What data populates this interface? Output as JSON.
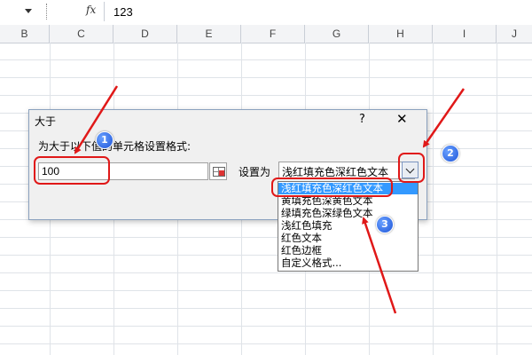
{
  "formula_bar": {
    "fx": "fx",
    "cancel": "✕",
    "enter": "✓",
    "value": "123"
  },
  "columns": [
    "B",
    "C",
    "D",
    "E",
    "F",
    "G",
    "H",
    "I",
    "J"
  ],
  "dialog": {
    "title": "大于",
    "help": "?",
    "close": "✕",
    "prompt": "为大于以下值的单元格设置格式:",
    "value": "100",
    "set_label": "设置为",
    "selected_format": "浅红填充色深红色文本",
    "options": [
      "浅红填充色深红色文本",
      "黄填充色深黄色文本",
      "绿填充色深绿色文本",
      "浅红色填充",
      "红色文本",
      "红色边框",
      "自定义格式..."
    ]
  },
  "annotations": [
    "1",
    "2",
    "3"
  ],
  "colors": {
    "annotation_red": "#e01818",
    "badge_blue": "#1e55d8",
    "selection_blue": "#3399ff"
  }
}
